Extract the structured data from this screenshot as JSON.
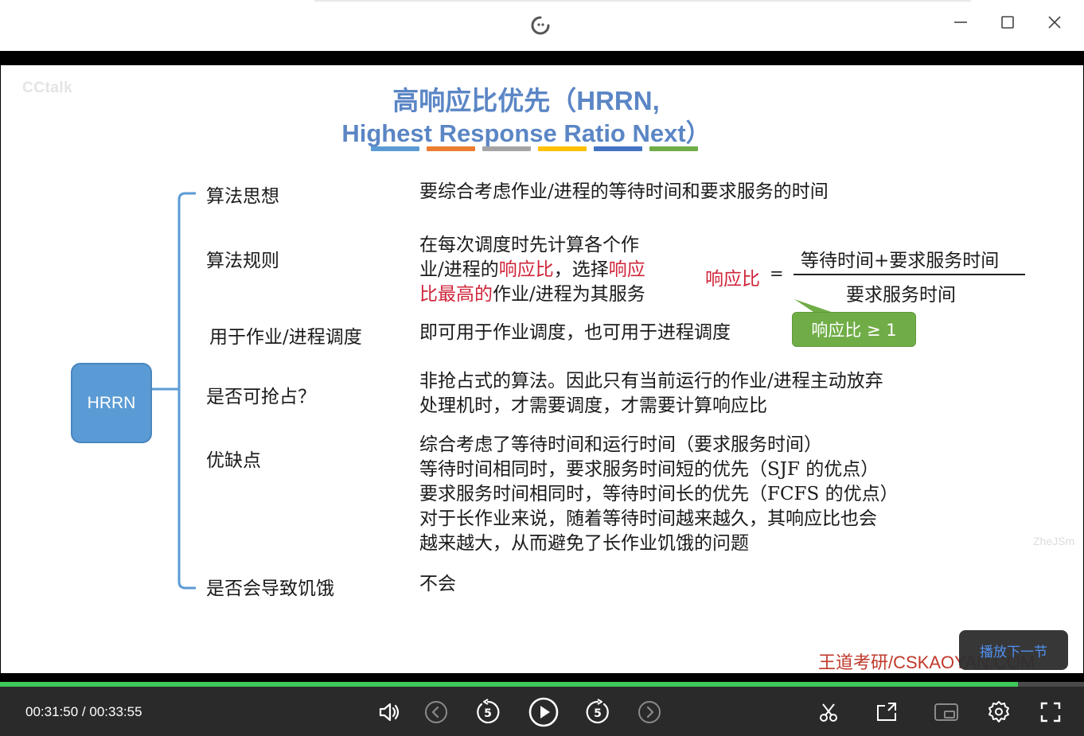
{
  "window": {
    "minimize_label": "—",
    "maximize_label": "□",
    "close_label": "✕"
  },
  "slide": {
    "watermark_left": "CCtalk",
    "watermark_right": "ZheJSm",
    "title_line1": "高响应比优先（HRRN,",
    "title_line2": "Highest Response Ratio Next）",
    "title_bar_colors": [
      "#5b9bd5",
      "#ed7d31",
      "#a5a5a5",
      "#ffc000",
      "#4472c4",
      "#70ad47"
    ],
    "root_label": "HRRN",
    "rows": [
      {
        "label": "算法思想",
        "desc": [
          "要综合考虑作业/进程的等待时间和要求服务的时间"
        ]
      },
      {
        "label": "算法规则",
        "desc_parts": {
          "l1": "在每次调度时先计算各个作",
          "l2a": "业/进程的",
          "l2b": "响应比",
          "l2c": "，选择",
          "l2d": "响应",
          "l3a": "比最高的",
          "l3b": "作业/进程为其服务"
        }
      },
      {
        "label": "用于作业/进程调度",
        "desc": [
          "即可用于作业调度，也可用于进程调度"
        ]
      },
      {
        "label": "是否可抢占？",
        "desc": [
          "非抢占式的算法。因此只有当前运行的作业/进程主动放弃",
          "处理机时，才需要调度，才需要计算响应比"
        ]
      },
      {
        "label": "优缺点",
        "desc": [
          "综合考虑了等待时间和运行时间（要求服务时间）",
          "等待时间相同时，要求服务时间短的优先（SJF 的优点）",
          "要求服务时间相同时，等待时间长的优先（FCFS 的优点）",
          "对于长作业来说，随着等待时间越来越久，其响应比也会",
          "越来越大，从而避免了长作业饥饿的问题"
        ]
      },
      {
        "label": "是否会导致饥饿",
        "desc": [
          "不会"
        ]
      }
    ],
    "formula": {
      "label": "响应比",
      "equals": "=",
      "numerator": "等待时间+要求服务时间",
      "denominator": "要求服务时间",
      "callout": "响应比 ≥ 1",
      "callout_color": "#70ad47"
    },
    "brand": "王道考研/CSKAOYAN.COM",
    "next_button": "播放下一节"
  },
  "player": {
    "current_time": "00:31:50",
    "separator": " / ",
    "total_time": "00:33:55",
    "progress": 0.939,
    "progress_color": "#3fc85a",
    "rewind_seconds": "5",
    "forward_seconds": "5",
    "icons": [
      "volume-icon",
      "previous-icon",
      "rewind-5-icon",
      "play-icon",
      "forward-5-icon",
      "next-icon",
      "clip-icon",
      "share-icon",
      "pip-icon",
      "settings-icon",
      "fullscreen-icon"
    ]
  }
}
